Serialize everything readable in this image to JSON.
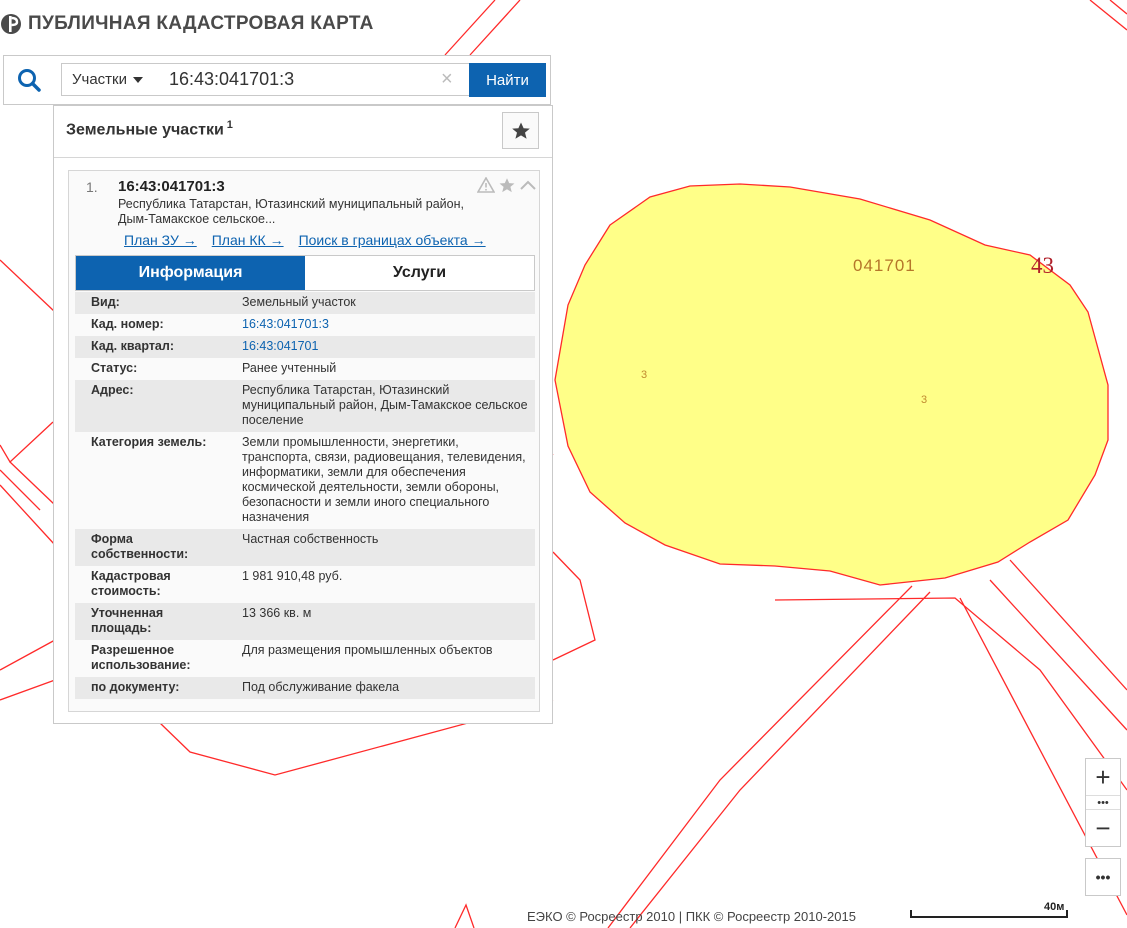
{
  "header": {
    "logo_text": "ПУБЛИЧНАЯ КАДАСТРОВАЯ КАРТА"
  },
  "search": {
    "type_label": "Участки",
    "query": "16:43:041701:3",
    "clear_symbol": "×",
    "find_label": "Найти"
  },
  "panel": {
    "title": "Земельные участки",
    "count": "1",
    "result": {
      "index": "1.",
      "number": "16:43:041701:3",
      "address_short": "Республика Татарстан, Ютазинский муниципальный район, Дым-Тамакское сельское...",
      "links": [
        "План ЗУ →",
        "План КК →",
        "Поиск в границах объекта →"
      ],
      "tabs": [
        "Информация",
        "Услуги"
      ],
      "info": [
        {
          "key": "Вид:",
          "value": "Земельный участок"
        },
        {
          "key": "Кад. номер:",
          "value": "16:43:041701:3"
        },
        {
          "key": "Кад. квартал:",
          "value": "16:43:041701"
        },
        {
          "key": "Статус:",
          "value": "Ранее учтенный"
        },
        {
          "key": "Адрес:",
          "value": "Республика Татарстан, Ютазинский муниципальный район, Дым-Тамакское сельское поселение"
        },
        {
          "key": "Категория земель:",
          "value": "Земли промышленности, энергетики, транспорта, связи, радиовещания, телевидения, информатики, земли для обеспечения космической деятельности, земли обороны, безопасности и земли иного специального назначения"
        },
        {
          "key": "Форма собственности:",
          "value": "Частная собственность"
        },
        {
          "key": "Кадастровая стоимость:",
          "value": "1 981 910,48 руб."
        },
        {
          "key": "Уточненная площадь:",
          "value": "13 366 кв. м"
        },
        {
          "key": "Разрешенное использование:",
          "value": "Для размещения промышленных объектов"
        },
        {
          "key": "по документу:",
          "value": "Под обслуживание факела"
        }
      ]
    }
  },
  "map": {
    "quarter_label": "041701",
    "district_label": "43",
    "parcel_label_1": "3",
    "parcel_label_2": "3",
    "parcel_fill": "#ffff88",
    "boundary_color": "#ff2a2a"
  },
  "controls": {
    "zoom_in": "+",
    "zoom_out": "−",
    "zoom_mid": "•••",
    "more": "•••"
  },
  "footer": {
    "copyright": "ЕЭКО © Росреестр 2010 | ПКК © Росреестр 2010-2015",
    "scale_label": "40м"
  },
  "colors": {
    "accent": "#0d63b0"
  }
}
